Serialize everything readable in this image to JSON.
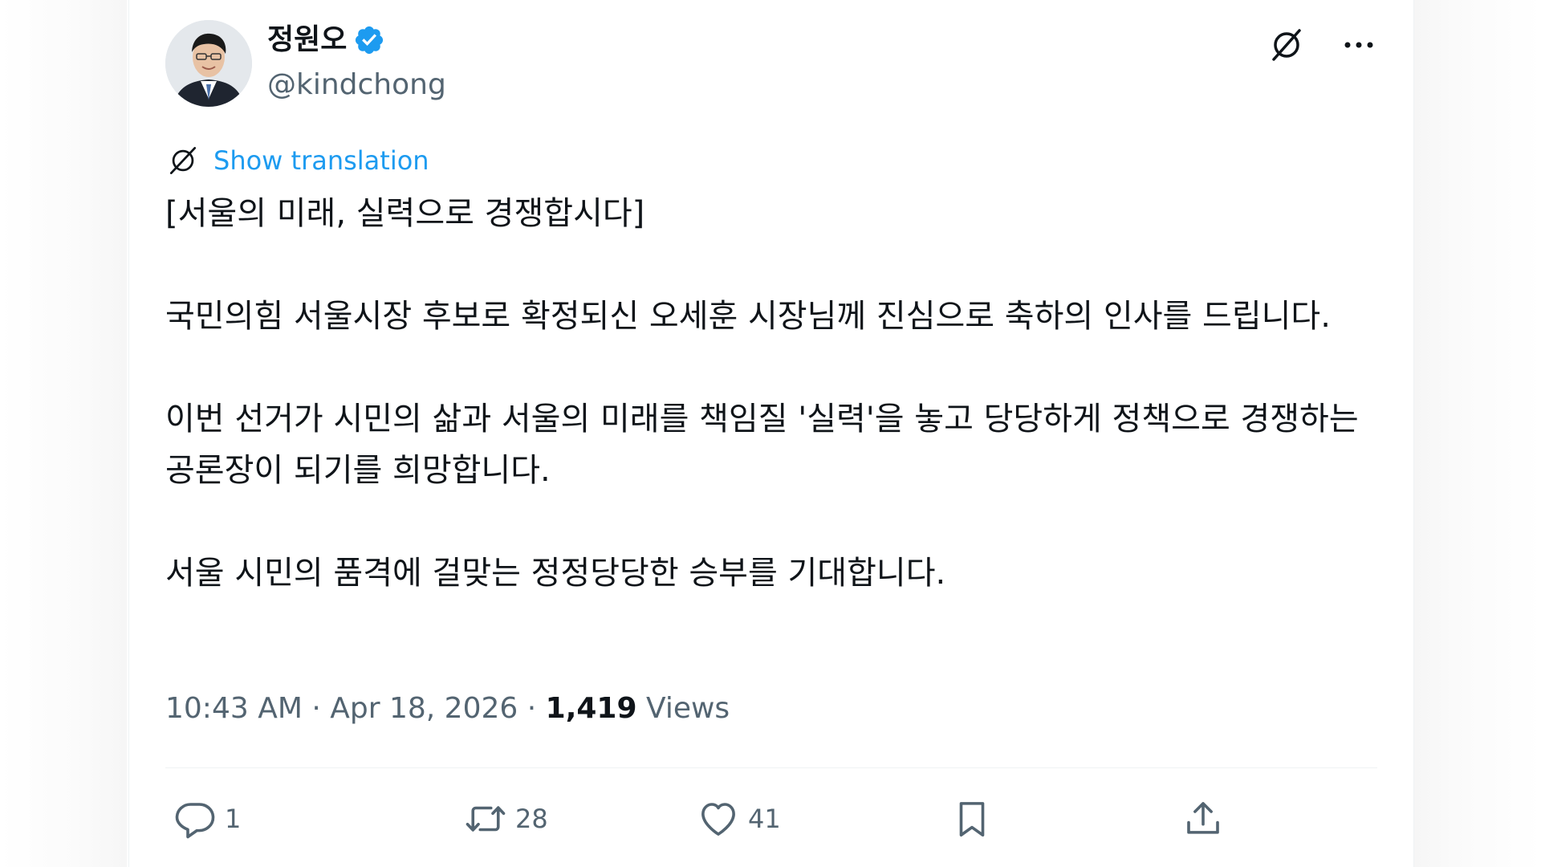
{
  "tweet": {
    "author": {
      "display_name": "정원오",
      "handle": "@kindchong",
      "verified": true,
      "avatar_icon": "profile-photo"
    },
    "header_icons": {
      "grok": "grok-icon",
      "more": "more-options-icon"
    },
    "show_translation": "Show translation",
    "paragraphs": [
      "[서울의 미래, 실력으로 경쟁합시다]",
      "국민의힘 서울시장 후보로 확정되신 오세훈 시장님께 진심으로 축하의 인사를 드립니다.",
      "이번 선거가 시민의 삶과 서울의 미래를 책임질 '실력'을 놓고 당당하게 정책으로 경쟁하는 공론장이 되기를 희망합니다.",
      "서울 시민의 품격에 걸맞는 정정당당한 승부를 기대합니다."
    ],
    "meta": {
      "time": "10:43 AM",
      "separator": "·",
      "date": "Apr 18, 2026",
      "views_count": "1,419",
      "views_label": "Views"
    },
    "actions": {
      "reply_count": "1",
      "retweet_count": "28",
      "like_count": "41"
    }
  },
  "colors": {
    "accent_blue": "#1d9bf0",
    "text_primary": "#0f1419",
    "text_secondary": "#536471",
    "divider": "#eff3f4"
  }
}
